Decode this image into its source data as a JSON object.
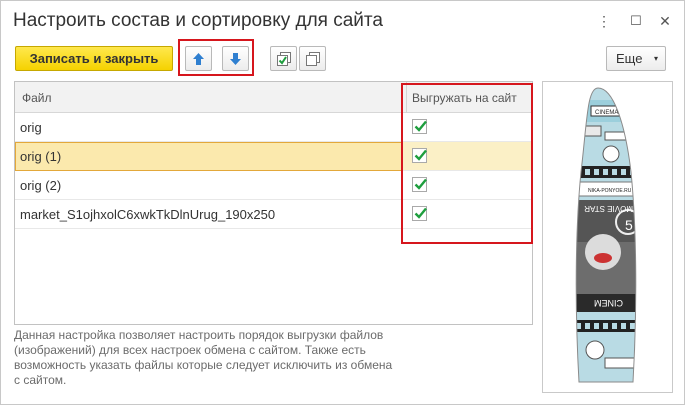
{
  "window": {
    "title": "Настроить состав и сортировку для сайта",
    "menu_icon": "⋮",
    "maximize_icon": "☐",
    "close_icon": "✕"
  },
  "toolbar": {
    "save_label": "Записать и закрыть",
    "more_label": "Еще",
    "more_caret": "▾"
  },
  "table": {
    "columns": [
      "Файл",
      "Выгружать на сайт"
    ],
    "rows": [
      {
        "name": "orig",
        "checked": true
      },
      {
        "name": "orig (1)",
        "checked": true
      },
      {
        "name": "orig (2)",
        "checked": true
      },
      {
        "name": "market_S1ojhxolC6xwkTkDlnUrug_190x250",
        "checked": true
      }
    ]
  },
  "note": "Данная настройка позволяет настроить порядок выгрузки файлов (изображений) для всех настроек обмена с сайтом. Также есть возможность указать файлы которые следует исключить из обмена с сайтом.",
  "image_panel": {
    "texts": [
      "CINEMA",
      "NIKA-PONYOE.RU",
      "MOVIE STAR",
      "CINEM",
      "5"
    ]
  },
  "colors": {
    "accent_yellow": "#f5d200",
    "highlight_red": "#d6161d",
    "arrow_blue": "#2f7fd0",
    "check_green": "#1e9e3e"
  }
}
